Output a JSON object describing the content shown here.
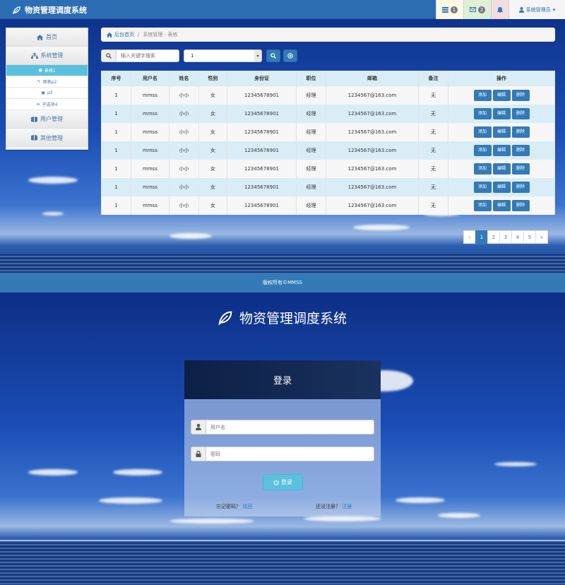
{
  "admin": {
    "brand": "物资管理调度系统",
    "topbar": {
      "tasks_count": "1",
      "messages_count": "2",
      "user_label": "系统管理员"
    },
    "sidebar": {
      "home": "首页",
      "system_mgmt": "系统管理",
      "sub_items": [
        "表格1",
        "图表p2",
        "p3",
        "子选项4"
      ],
      "user_mgmt": "用户管理",
      "other_mgmt": "其他管理"
    },
    "breadcrumb": {
      "home": "后台首页",
      "sep": "/",
      "current": "系统管理 - 表格"
    },
    "search": {
      "placeholder": "输入关键字搜索",
      "select_value": "1"
    },
    "table": {
      "headers": [
        "序号",
        "用户名",
        "姓名",
        "性别",
        "身份证",
        "职位",
        "邮箱",
        "备注",
        "操作"
      ],
      "rows": [
        [
          "1",
          "mmss",
          "小小",
          "女",
          "12345678901",
          "经理",
          "1234567@163.com",
          "无"
        ],
        [
          "1",
          "mmss",
          "小小",
          "女",
          "12345678901",
          "经理",
          "1234567@163.com",
          "无"
        ],
        [
          "1",
          "mmss",
          "小小",
          "女",
          "12345678901",
          "经理",
          "1234567@163.com",
          "无"
        ],
        [
          "1",
          "mmss",
          "小小",
          "女",
          "12345678901",
          "经理",
          "1234567@163.com",
          "无"
        ],
        [
          "1",
          "mmss",
          "小小",
          "女",
          "12345678901",
          "经理",
          "1234567@163.com",
          "无"
        ],
        [
          "1",
          "mmss",
          "小小",
          "女",
          "12345678901",
          "经理",
          "1234567@163.com",
          "无"
        ],
        [
          "1",
          "mmss",
          "小小",
          "女",
          "12345678901",
          "经理",
          "1234567@163.com",
          "无"
        ]
      ],
      "actions": [
        "添加",
        "编辑",
        "删除"
      ]
    },
    "pagination": [
      "«",
      "1",
      "2",
      "3",
      "4",
      "5",
      "»"
    ],
    "footer": "版权所有©MMSS"
  },
  "login": {
    "title": "物资管理调度系统",
    "box_title": "登录",
    "username_placeholder": "用户名",
    "password_placeholder": "密码",
    "submit": "登录",
    "forgot_text": "忘记密码？",
    "forgot_link": "找回",
    "register_text": "还没注册？",
    "register_link": "注册"
  },
  "colors": {
    "primary": "#337ab7",
    "info": "#5bc0de",
    "table_stripe": "#d9edf7"
  }
}
